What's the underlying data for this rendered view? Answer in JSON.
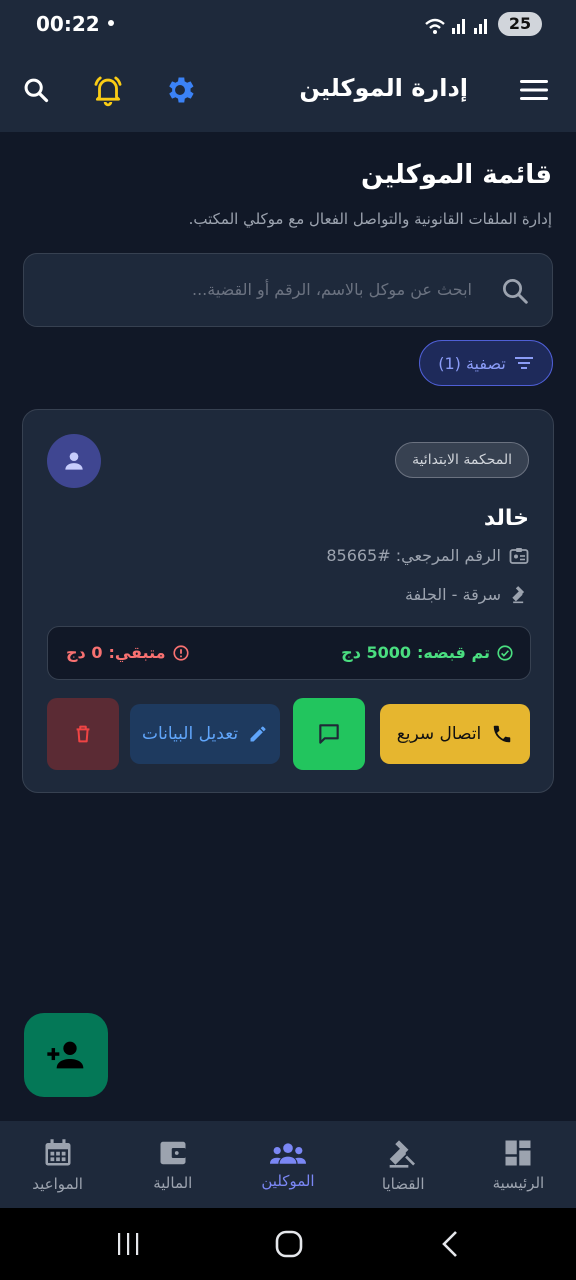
{
  "status_bar": {
    "time": "00:22",
    "battery": "25"
  },
  "app_bar": {
    "title": "إدارة الموكلين"
  },
  "header": {
    "title": "قائمة الموكلين",
    "subtitle": "إدارة الملفات القانونية والتواصل الفعال مع موكلي المكتب."
  },
  "search": {
    "placeholder": "ابحث عن موكل بالاسم، الرقم أو القضية..."
  },
  "filter": {
    "label": "تصفية (1)"
  },
  "client": {
    "court": "المحكمة الابتدائية",
    "name": "خالد",
    "reference": "الرقم المرجعي: #85665",
    "case": "سرقة - الجلفة",
    "paid_label": "تم قبضه:",
    "paid_value": "5000 دج",
    "remaining_label": "متبقي:",
    "remaining_value": "0 دج",
    "call_label": "اتصال سريع",
    "edit_label": "تعديل البيانات"
  },
  "bottom_nav": [
    {
      "label": "الرئيسية",
      "icon": "dashboard-icon"
    },
    {
      "label": "القضايا",
      "icon": "gavel-icon"
    },
    {
      "label": "الموكلين",
      "icon": "people-icon",
      "active": true
    },
    {
      "label": "المالية",
      "icon": "wallet-icon"
    },
    {
      "label": "المواعيد",
      "icon": "calendar-icon"
    }
  ],
  "colors": {
    "accent": "#7b87f5",
    "call": "#e6b62f",
    "message": "#22c55e",
    "fab": "#047857",
    "paid": "#4ade80",
    "remaining": "#f87171"
  }
}
